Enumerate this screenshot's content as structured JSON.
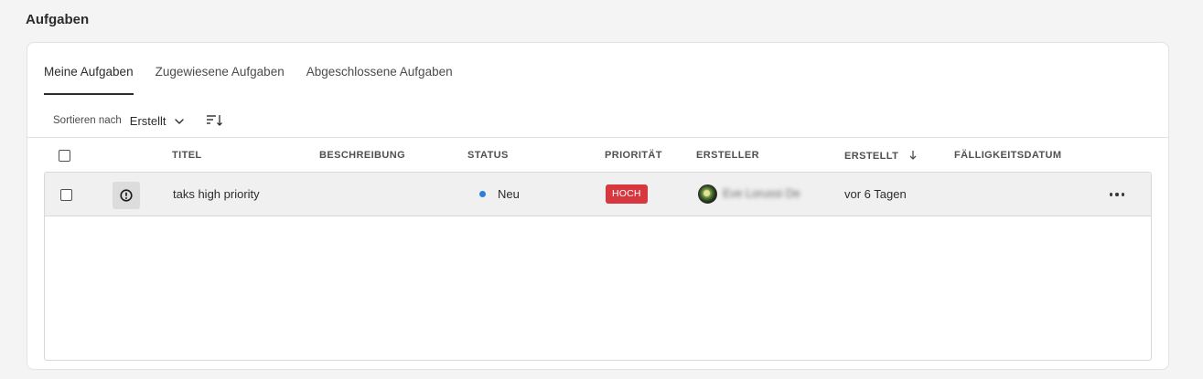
{
  "page": {
    "title": "Aufgaben"
  },
  "tabs": [
    {
      "label": "Meine Aufgaben",
      "active": true
    },
    {
      "label": "Zugewiesene Aufgaben",
      "active": false
    },
    {
      "label": "Abgeschlossene Aufgaben",
      "active": false
    }
  ],
  "sort": {
    "label": "Sortieren nach",
    "value": "Erstellt",
    "chevron_icon": "chevron-down-icon",
    "direction_icon": "sort-descending-icon"
  },
  "table": {
    "columns": {
      "title": "TITEL",
      "description": "BESCHREIBUNG",
      "status": "STATUS",
      "priority": "PRIORITÄT",
      "creator": "ERSTELLER",
      "created": "ERSTELLT",
      "created_sort_icon": "arrow-down-icon",
      "due_date": "FÄLLIGKEITSDATUM"
    },
    "rows": [
      {
        "title": "taks high priority",
        "description": "",
        "priority_icon": "alert-circle-icon",
        "status": "Neu",
        "status_color": "#2b7de1",
        "priority": "HOCH",
        "priority_color": "#d7373f",
        "creator_name": "Eve Lorussi De",
        "created": "vor 6 Tagen",
        "due_date": "",
        "actions_icon": "more-horizontal-icon"
      }
    ]
  }
}
